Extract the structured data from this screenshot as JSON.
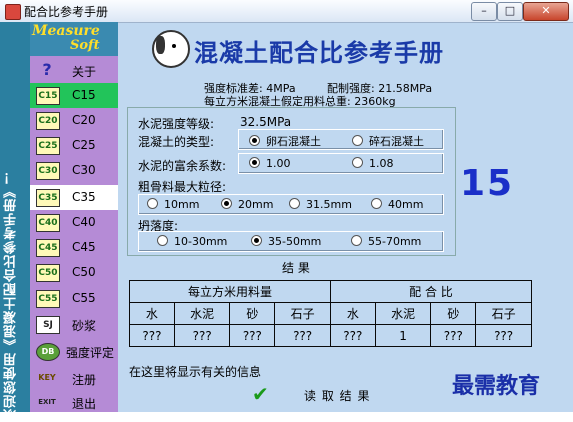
{
  "window": {
    "title": "配合比参考手册",
    "min": "–",
    "max": "□",
    "close": "✕"
  },
  "banner": {
    "vertical_text": "欢迎您使用《混凝土配合比参考手册》！"
  },
  "logo": {
    "line1": "Measure",
    "line2": "Soft"
  },
  "sidebar": {
    "items": [
      {
        "icon": "?",
        "label": "关于"
      },
      {
        "icon": "C15",
        "label": "C15"
      },
      {
        "icon": "C20",
        "label": "C20"
      },
      {
        "icon": "C25",
        "label": "C25"
      },
      {
        "icon": "C30",
        "label": "C30"
      },
      {
        "icon": "C35",
        "label": "C35"
      },
      {
        "icon": "C40",
        "label": "C40"
      },
      {
        "icon": "C45",
        "label": "C45"
      },
      {
        "icon": "C50",
        "label": "C50"
      },
      {
        "icon": "C55",
        "label": "C55"
      },
      {
        "icon": "SJ",
        "label": "砂浆"
      },
      {
        "icon": "DB",
        "label": "强度评定"
      },
      {
        "icon": "KEY",
        "label": "注册"
      },
      {
        "icon": "EXIT",
        "label": "退出"
      }
    ]
  },
  "header": {
    "title": "混凝土配合比参考手册",
    "std_dev": "强度标准差: 4MPa",
    "design_strength": "配制强度: 21.58MPa",
    "total_usage": "每立方米混凝土假定用料总重: 2360kg"
  },
  "form": {
    "cement_grade_label": "水泥强度等级:",
    "cement_grade_value": "32.5MPa",
    "type_label": "混凝土的类型:",
    "type_opt1": "卵石混凝土",
    "type_opt2": "碎石混凝土",
    "factor_label": "水泥的富余系数:",
    "factor_opt1": "1.00",
    "factor_opt2": "1.08",
    "agg_label": "粗骨料最大粒径:",
    "agg_opts": [
      "10mm",
      "20mm",
      "31.5mm",
      "40mm"
    ],
    "slump_label": "坍落度:",
    "slump_opts": [
      "10-30mm",
      "35-50mm",
      "55-70mm"
    ]
  },
  "big_number": "15",
  "results": {
    "title": "结    果",
    "group1": "每立方米用料量",
    "group2": "配 合 比",
    "cols": [
      "水",
      "水泥",
      "砂",
      "石子",
      "水",
      "水泥",
      "砂",
      "石子"
    ],
    "values": [
      "???",
      "???",
      "???",
      "???",
      "???",
      "1",
      "???",
      "???"
    ]
  },
  "status_text": "在这里将显示有关的信息",
  "read_button": "读 取 结 果",
  "watermark": "最需教育"
}
